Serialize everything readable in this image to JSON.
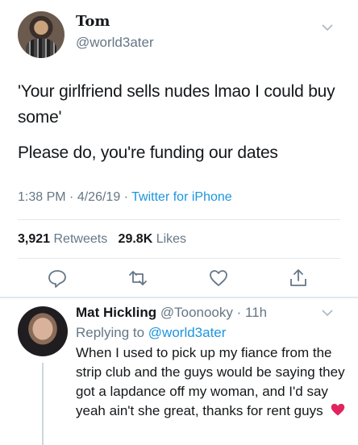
{
  "tweet": {
    "display_name": "Tom",
    "handle": "@world3ater",
    "text_line_1": "'Your girlfriend sells nudes lmao I could buy some'",
    "text_line_2": "Please do, you're funding our dates",
    "time": "1:38 PM",
    "date": "4/26/19",
    "source": "Twitter for iPhone",
    "retweet_count": "3,921",
    "retweet_label": "Retweets",
    "like_count": "29.8K",
    "like_label": "Likes",
    "actions": [
      "reply-icon",
      "retweet-icon",
      "like-icon",
      "share-icon"
    ]
  },
  "reply": {
    "display_name": "Mat Hickling",
    "handle": "@Toonooky",
    "age": "11h",
    "replying_prefix": "Replying to",
    "replying_to": "@world3ater",
    "text": "When I used to pick up my fiance from the strip club and the guys would be saying they got a lapdance off my woman, and I'd say yeah ain't she great, thanks for rent guys",
    "emoji": "red-heart"
  },
  "colors": {
    "link": "#1b95e0",
    "secondary_text": "#657786",
    "divider": "#e1e8ed",
    "heart_emoji": "#e0245e"
  }
}
